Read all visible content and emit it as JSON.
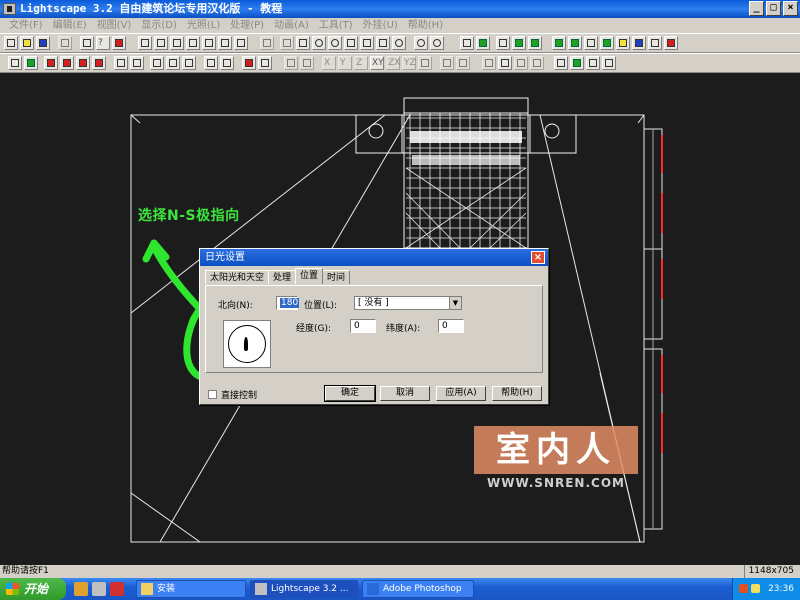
{
  "window": {
    "title": "Lightscape 3.2 自由建筑论坛专用汉化版 - 教程"
  },
  "menu": [
    "文件(F)",
    "编辑(E)",
    "视图(V)",
    "显示(D)",
    "光照(L)",
    "处理(P)",
    "动画(A)",
    "工具(T)",
    "外挂(U)",
    "帮助(H)"
  ],
  "annotation": "选择N-S极指向",
  "dialog": {
    "title": "日光设置",
    "tabs": [
      "太阳光和天空",
      "处理",
      "位置",
      "时间"
    ],
    "active_tab": "位置",
    "north_label": "北向(N):",
    "north_value": "180",
    "location_label": "位置(L):",
    "location_value": "[ 没有 ]",
    "longitude_label": "经度(G):",
    "longitude_value": "0",
    "latitude_label": "纬度(A):",
    "latitude_value": "0",
    "direct_control_label": "直接控制",
    "buttons": {
      "ok": "确定",
      "cancel": "取消",
      "apply": "应用(A)",
      "help": "帮助(H)"
    }
  },
  "status": {
    "text": "帮助请按F1",
    "coords": "1148x705"
  },
  "taskbar": {
    "start": "开始",
    "tasks": [
      "安装",
      "Lightscape 3.2 ...",
      "Adobe Photoshop"
    ],
    "clock": "23:36"
  },
  "watermark": {
    "text": "室内人",
    "url": "WWW.SNREN.COM"
  }
}
